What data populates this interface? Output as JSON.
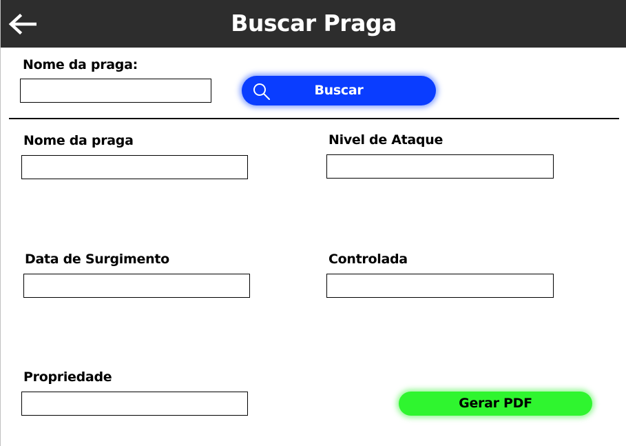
{
  "header": {
    "title": "Buscar Praga",
    "back_icon": "arrow-left-icon"
  },
  "search": {
    "label": "Nome da praga:",
    "value": "",
    "button_label": "Buscar",
    "button_icon": "search-icon",
    "button_color": "#0a3dff"
  },
  "form": {
    "nome_label": "Nome da praga",
    "nome_value": "",
    "nivel_label": "Nivel de Ataque",
    "nivel_value": "",
    "data_label": "Data de Surgimento",
    "data_value": "",
    "controlada_label": "Controlada",
    "controlada_value": "",
    "propriedade_label": "Propriedade",
    "propriedade_value": ""
  },
  "actions": {
    "pdf_label": "Gerar PDF",
    "pdf_color": "#2ff52f"
  }
}
